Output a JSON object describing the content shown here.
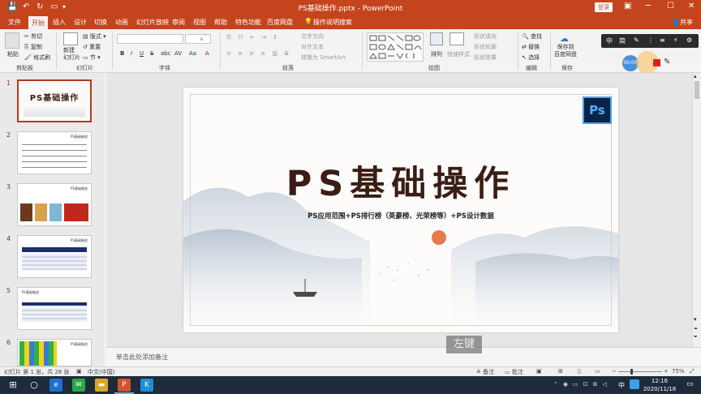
{
  "window": {
    "title": "PS基础操作.pptx  -  PowerPoint",
    "login_label": "登录",
    "quick_access": [
      "save-icon",
      "undo-icon",
      "redo-icon",
      "presentation-icon"
    ],
    "controls": {
      "ribbon_options": "▣",
      "minimize": "─",
      "maximize": "☐",
      "close": "✕"
    }
  },
  "tabs": [
    "文件",
    "开始",
    "插入",
    "设计",
    "切换",
    "动画",
    "幻灯片放映",
    "审阅",
    "视图",
    "帮助",
    "特色功能",
    "百度网盘"
  ],
  "tell_me": "操作说明搜索",
  "share_label": "共享",
  "ribbon": {
    "clipboard": {
      "label": "剪贴板",
      "paste": "粘贴",
      "cut": "剪切",
      "copy": "复制",
      "format_painter": "格式刷"
    },
    "slides": {
      "label": "幻灯片",
      "new_slide": "新建\n幻灯片",
      "layout": "版式",
      "reset": "重置",
      "section": "节"
    },
    "font": {
      "label": "字体",
      "bold": "B",
      "italic": "I",
      "underline": "U",
      "strike": "S",
      "abc": "abc",
      "av": "AV",
      "aa": "Aa",
      "font_color": "A"
    },
    "paragraph": {
      "label": "段落",
      "text_direction": "文字方向",
      "align_text": "对齐文本",
      "smartart": "转换为 SmartArt"
    },
    "drawing": {
      "label": "绘图",
      "arrange": "排列",
      "quick_styles": "快速样式",
      "shape_fill": "形状填充",
      "shape_outline": "形状轮廓",
      "shape_effects": "形状效果"
    },
    "editing": {
      "label": "编辑",
      "find": "查找",
      "replace": "替换",
      "select": "选择"
    },
    "save": {
      "label": "保存",
      "save_baidu": "保存到\n百度网盘"
    }
  },
  "floating_toolbar": [
    "中",
    "简",
    "✎",
    "⋮",
    "≡",
    "⚡",
    "⚙"
  ],
  "recorder": {
    "time": "00:00"
  },
  "thumbnails": [
    {
      "num": "1",
      "title": "PS基础操作"
    },
    {
      "num": "2",
      "title": "PS基础概述"
    },
    {
      "num": "3",
      "title": "PS基础概述"
    },
    {
      "num": "4",
      "title": "PS基础概述"
    },
    {
      "num": "5",
      "title": "PS基础概述"
    },
    {
      "num": "6",
      "title": "PS基础概述"
    }
  ],
  "slide": {
    "title": "PS基础操作",
    "subtitle": "PS应用范围+PS排行榜（英豪榜、光荣榜等）+PS设计数据",
    "logo": "Ps"
  },
  "notes_placeholder": "单击此处添加备注",
  "overlay_key": "左键",
  "status": {
    "slide_counter": "幻灯片 第 1 张，共 28 张",
    "language": "中文(中国)",
    "notes_btn": "备注",
    "comments_btn": "批注",
    "zoom": "75%"
  },
  "taskbar": {
    "time": "12:16",
    "date": "2020/11/18",
    "ime": "中"
  }
}
